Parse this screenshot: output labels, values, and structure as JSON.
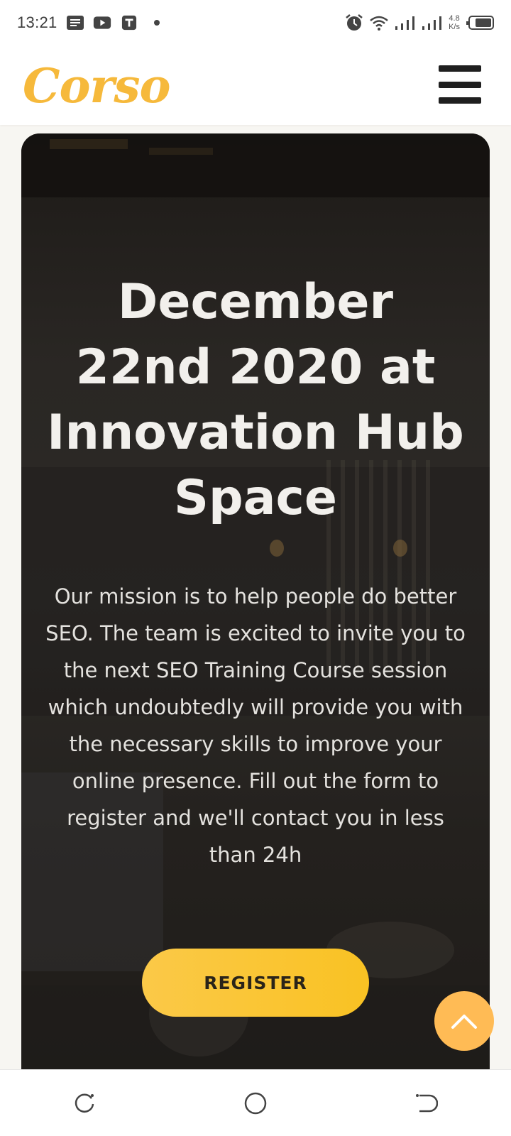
{
  "status_bar": {
    "time": "13:21",
    "net_speed_value": "4.8",
    "net_speed_unit": "K/s",
    "icons": [
      "notes-icon",
      "youtube-icon",
      "t-app-icon",
      "notification-dot-icon",
      "alarm-icon",
      "wifi-icon",
      "signal-icon",
      "signal-icon",
      "battery-icon"
    ]
  },
  "header": {
    "logo_text": "Corso",
    "menu_icon": "hamburger-menu-icon"
  },
  "hero": {
    "title": "December 22nd 2020 at Innovation Hub Space",
    "description": "Our mission is to help people do better SEO. The team is excited to invite you to the next SEO Training Course session which undoubtedly will provide you with the necessary skills to improve your online presence. Fill out the form to register and we'll contact you in less than 24h",
    "register_label": "REGISTER"
  },
  "scroll_top": {
    "icon": "chevron-up-icon"
  },
  "nav_bar": {
    "icons": [
      "recents-icon",
      "home-icon",
      "back-icon"
    ]
  },
  "colors": {
    "brand": "#f6b93b",
    "button": "#f9c223",
    "scroll_top": "#ffbb55"
  }
}
